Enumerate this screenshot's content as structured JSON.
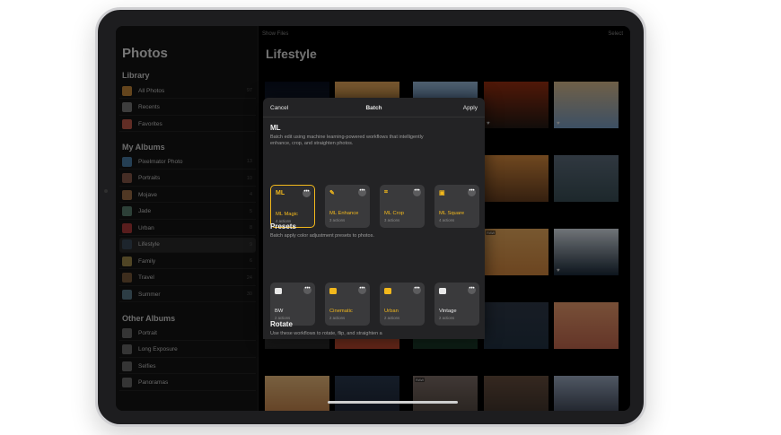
{
  "topbar": {
    "show_files": "Show Files",
    "select": "Select"
  },
  "sidebar": {
    "title": "Photos",
    "library_heading": "Library",
    "library": [
      {
        "label": "All Photos",
        "count": "97",
        "color": "#c98a3a"
      },
      {
        "label": "Recents",
        "count": "",
        "color": "#7a7a7a"
      },
      {
        "label": "Favorites",
        "count": "",
        "color": "#c25a4a"
      }
    ],
    "albums_heading": "My Albums",
    "albums": [
      {
        "label": "Pixelmator Photo",
        "count": "13",
        "color": "#4a7fa8"
      },
      {
        "label": "Portraits",
        "count": "10",
        "color": "#8a5a4a"
      },
      {
        "label": "Mojave",
        "count": "4",
        "color": "#a07048"
      },
      {
        "label": "Jade",
        "count": "5",
        "color": "#5a8070"
      },
      {
        "label": "Urban",
        "count": "8",
        "color": "#b03a3a"
      },
      {
        "label": "Lifestyle",
        "count": "9",
        "color": "#3a4a5a"
      },
      {
        "label": "Family",
        "count": "6",
        "color": "#a08a4a"
      },
      {
        "label": "Travel",
        "count": "24",
        "color": "#7a5a3a"
      },
      {
        "label": "Summer",
        "count": "30",
        "color": "#5a7a8a"
      }
    ],
    "other_heading": "Other Albums",
    "other": [
      {
        "label": "Portrait",
        "count": "",
        "color": "#6a6a6a"
      },
      {
        "label": "Long Exposure",
        "count": "",
        "color": "#6a6a6a"
      },
      {
        "label": "Selfies",
        "count": "",
        "color": "#6a6a6a"
      },
      {
        "label": "Panoramas",
        "count": "",
        "color": "#6a6a6a"
      }
    ]
  },
  "main": {
    "title": "Lifestyle"
  },
  "sheet": {
    "cancel": "Cancel",
    "title": "Batch",
    "apply": "Apply",
    "ml_title": "ML",
    "ml_desc": "Batch edit using machine learning-powered workflows that intelligently enhance, crop, and straighten photos.",
    "ml_cards": [
      {
        "icon": "ML",
        "name": "ML Magic",
        "sub": "4 actions"
      },
      {
        "icon": "✎",
        "name": "ML Enhance",
        "sub": "3 actions"
      },
      {
        "icon": "⌗",
        "name": "ML Crop",
        "sub": "3 actions"
      },
      {
        "icon": "▣",
        "name": "ML Square",
        "sub": "4 actions"
      }
    ],
    "presets_title": "Presets",
    "presets_desc": "Batch apply color adjustment presets to photos.",
    "preset_cards": [
      {
        "name": "BW",
        "sub": "2 actions",
        "icon_color": "#e8e8e8"
      },
      {
        "name": "Cinematic",
        "sub": "2 actions",
        "icon_color": "#f2b81c"
      },
      {
        "name": "Urban",
        "sub": "2 actions",
        "icon_color": "#f2b81c"
      },
      {
        "name": "Vintage",
        "sub": "2 actions",
        "icon_color": "#e8e8e8"
      }
    ],
    "rotate_title": "Rotate",
    "rotate_desc": "Use these workflows to rotate, flip, and straighten a",
    "more_label": "•••"
  },
  "photo_badges": {
    "raw": "RAW"
  }
}
